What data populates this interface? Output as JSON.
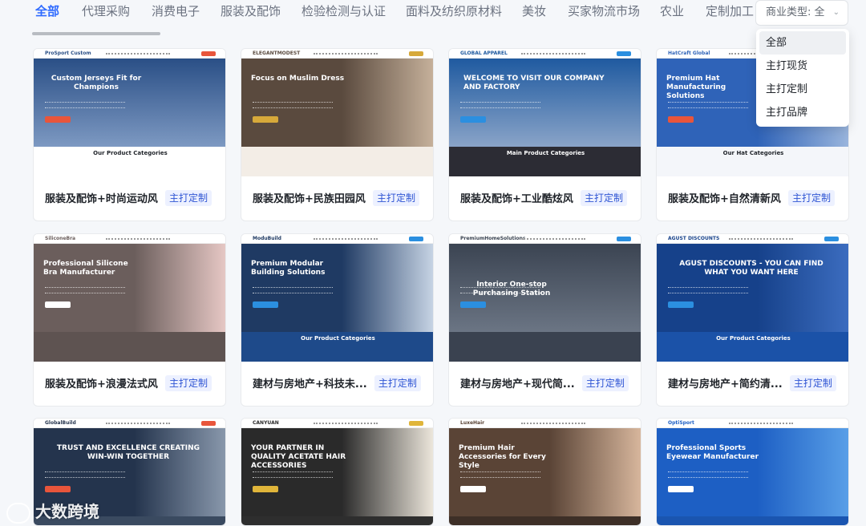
{
  "categories": [
    {
      "label": "全部",
      "active": true
    },
    {
      "label": "代理采购"
    },
    {
      "label": "消费电子"
    },
    {
      "label": "服装及配饰"
    },
    {
      "label": "检验检测与认证"
    },
    {
      "label": "面料及纺织原材料"
    },
    {
      "label": "美妆"
    },
    {
      "label": "买家物流市场"
    },
    {
      "label": "农业"
    },
    {
      "label": "定制加工"
    }
  ],
  "filter": {
    "label": "商业类型:",
    "value": "全"
  },
  "dropdown": {
    "options": [
      "全部",
      "主打现货",
      "主打定制",
      "主打品牌"
    ],
    "selected": 0
  },
  "cards": [
    {
      "name": "服装及配饰+时尚运动风",
      "badge": "主打定制",
      "logo": "ProSport Custom",
      "hero_title": "Custom Jerseys Fit for Champions",
      "section": "Our Product Categories",
      "colors": {
        "hero": "#2a4f86",
        "hero2": "#7d99c2",
        "btn": "#e8553b",
        "lower": "#ffffff",
        "text": "#1f2329"
      }
    },
    {
      "name": "服装及配饰+民族田园风",
      "badge": "主打定制",
      "logo": "ELEGANTMODEST",
      "hero_title": "Focus on Muslim Dress",
      "section": "",
      "colors": {
        "hero": "#5a4a3e",
        "hero2": "#c7b29c",
        "btn": "#d7a93a",
        "lower": "#f3ede6",
        "text": "#1f2329"
      }
    },
    {
      "name": "服装及配饰+工业酷炫风",
      "badge": "主打定制",
      "logo": "GLOBAL APPAREL",
      "hero_title": "WELCOME TO VISIT OUR COMPANY AND FACTORY",
      "section": "Main Product Categories",
      "colors": {
        "hero": "#1f5aa0",
        "hero2": "#8aa4c8",
        "btn": "#2b8fe0",
        "lower": "#2c2c34",
        "text": "#ffffff"
      }
    },
    {
      "name": "服装及配饰+自然清新风",
      "badge": "主打定制",
      "logo": "HatCraft Global",
      "hero_title": "Premium Hat Manufacturing Solutions",
      "section": "Our Hat Categories",
      "colors": {
        "hero": "#2f63b8",
        "hero2": "#9bb6dd",
        "btn": "#e8553b",
        "lower": "#f4f6fa",
        "text": "#1f2329"
      }
    },
    {
      "name": "服装及配饰+浪漫法式风",
      "badge": "主打定制",
      "logo": "SiliconeBra",
      "hero_title": "Professional Silicone Bra Manufacturer",
      "section": "",
      "colors": {
        "hero": "#6b5e5c",
        "hero2": "#e8c9c6",
        "btn": "#ffffff",
        "lower": "#5e5351",
        "text": "#ffffff"
      }
    },
    {
      "name": "建材与房地产+科技未...",
      "badge": "主打定制",
      "logo": "ModuBuild",
      "hero_title": "Premium Modular Building Solutions",
      "section": "Our Product Categories",
      "colors": {
        "hero": "#1f3a63",
        "hero2": "#c9d6e6",
        "btn": "#2b8fe0",
        "lower": "#1e4a8a",
        "text": "#ffffff"
      }
    },
    {
      "name": "建材与房地产+现代简...",
      "badge": "主打定制",
      "logo": "PremiumHomeSolutions",
      "hero_title": "Interior One-stop Purchasing Station",
      "section": "",
      "colors": {
        "hero": "#3b4452",
        "hero2": "#6b7584",
        "btn": "#2b8fe0",
        "lower": "#3a4250",
        "text": "#ffffff"
      }
    },
    {
      "name": "建材与房地产+简约清...",
      "badge": "主打定制",
      "logo": "AGUST DISCOUNTS",
      "hero_title": "AGUST DISCOUNTS - YOU CAN FIND WHAT YOU WANT HERE",
      "section": "Our Product Categories",
      "colors": {
        "hero": "#16418a",
        "hero2": "#3c6dc0",
        "btn": "#2b8fe0",
        "lower": "#1b52a8",
        "text": "#ffffff"
      }
    },
    {
      "name": "",
      "badge": "",
      "logo": "GlobalBuild",
      "hero_title": "TRUST AND EXCELLENCE CREATING WIN-WIN TOGETHER",
      "section": "",
      "colors": {
        "hero": "#24344d",
        "hero2": "#8a99ad",
        "btn": "#e8553b",
        "lower": "#3a4a60",
        "text": "#ffffff"
      }
    },
    {
      "name": "",
      "badge": "",
      "logo": "CANYUAN",
      "hero_title": "YOUR PARTNER IN QUALITY ACETATE HAIR ACCESSORIES",
      "section": "",
      "colors": {
        "hero": "#2a2a2a",
        "hero2": "#efe9de",
        "btn": "#e0b53a",
        "lower": "#2e2e2e",
        "text": "#ffffff"
      }
    },
    {
      "name": "",
      "badge": "",
      "logo": "LuxeHair",
      "hero_title": "Premium Hair Accessories for Every Style",
      "section": "",
      "colors": {
        "hero": "#5a4436",
        "hero2": "#d9b89e",
        "btn": "#ffffff",
        "lower": "#3d2f27",
        "text": "#ffffff"
      }
    },
    {
      "name": "",
      "badge": "",
      "logo": "OptiSport",
      "hero_title": "Professional Sports Eyewear Manufacturer",
      "section": "",
      "colors": {
        "hero": "#1d5fc4",
        "hero2": "#5aa0e8",
        "btn": "#ffffff",
        "lower": "#1a55b0",
        "text": "#ffffff"
      }
    }
  ],
  "watermark": "大数跨境"
}
